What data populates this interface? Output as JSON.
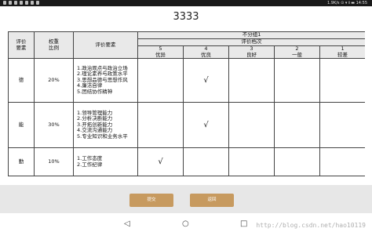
{
  "status_bar": {
    "right_text": "1.9K/s ⊙ ▾ 𝍪 ▬ 14:55"
  },
  "title": "3333",
  "table": {
    "headers": {
      "eval_elements": [
        "评价",
        "要素"
      ],
      "weight": [
        "权重",
        "比例"
      ],
      "eval_requirements": "评价要素",
      "group": "不分组1",
      "grade_levels": "评价档次",
      "grades": [
        {
          "score": "5",
          "label": "优异"
        },
        {
          "score": "4",
          "label": "优良"
        },
        {
          "score": "3",
          "label": "良好"
        },
        {
          "score": "2",
          "label": "一般"
        },
        {
          "score": "1",
          "label": "较差"
        }
      ]
    },
    "rows": [
      {
        "element": "德",
        "weight": "20%",
        "requirements": [
          "1.政治观点与政治立场",
          "2.理论素养与政策水平",
          "3.思想品德与思想作风",
          "4.廉洁自律",
          "5.团结协作精神"
        ],
        "checks": [
          "",
          "√",
          "",
          "",
          ""
        ]
      },
      {
        "element": "能",
        "weight": "30%",
        "requirements": [
          "1.领导管理能力",
          "2.分析决断能力",
          "3.开拓创新能力",
          "4.交流沟通能力",
          "5.专业知识和业务水平"
        ],
        "checks": [
          "",
          "√",
          "",
          "",
          ""
        ]
      },
      {
        "element": "勤",
        "weight": "10%",
        "requirements": [
          "1.工作态度",
          "2.工作纪律"
        ],
        "checks": [
          "√",
          "",
          "",
          "",
          ""
        ]
      }
    ]
  },
  "buttons": {
    "submit": "提交",
    "back": "返回"
  },
  "watermark": "http://blog.csdn.net/hao10119"
}
